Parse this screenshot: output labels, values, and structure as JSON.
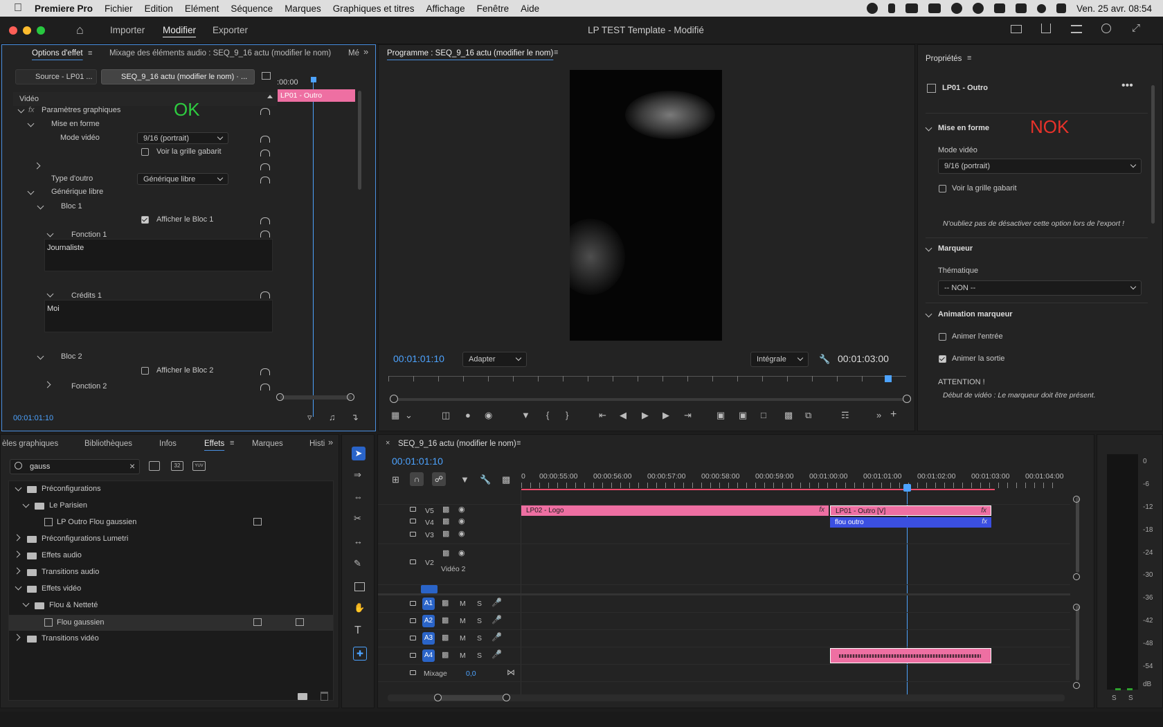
{
  "menubar": {
    "app": "Premiere Pro",
    "items": [
      "Fichier",
      "Edition",
      "Elément",
      "Séquence",
      "Marques",
      "Graphiques et titres",
      "Affichage",
      "Fenêtre",
      "Aide"
    ],
    "clock": "Ven. 25 avr.  08:54"
  },
  "titlebar": {
    "title": "LP TEST Template - Modifié",
    "ws": {
      "import": "Importer",
      "edit": "Modifier",
      "export": "Exporter"
    }
  },
  "effect_panel": {
    "tabs": {
      "options": "Options d'effet",
      "mixer": "Mixage des éléments audio : SEQ_9_16 actu (modifier le nom)",
      "more": "Mé"
    },
    "source_tab": "Source - LP01 ...",
    "seq_tab": "SEQ_9_16 actu (modifier le nom) · ...",
    "ruler": ":00:00",
    "clip_label": "LP01 - Outro",
    "ok": "OK",
    "video": "Vidéo",
    "fx": "fx",
    "graphic_params": "Paramètres graphiques",
    "mise_en_forme": "Mise en forme",
    "mode_video_label": "Mode vidéo",
    "mode_video_value": "9/16 (portrait)",
    "grid_label": "Voir la grille gabarit",
    "outro_type_label": "Type d'outro",
    "outro_type_value": "Générique libre",
    "generique": "Générique libre",
    "bloc1": "Bloc 1",
    "show_bloc1": "Afficher le Bloc 1",
    "fonction1": "Fonction 1",
    "fonction1_text": "Journaliste",
    "credits1": "Crédits 1",
    "credits1_text": "Moi",
    "bloc2": "Bloc 2",
    "show_bloc2": "Afficher le Bloc 2",
    "fonction2": "Fonction 2",
    "timecode": "00:01:01:10"
  },
  "program": {
    "title": "Programme : SEQ_9_16 actu (modifier le nom)",
    "tc_left": "00:01:01:10",
    "fit": "Adapter",
    "quality": "Intégrale",
    "tc_right": "00:01:03:00"
  },
  "properties": {
    "title": "Propriétés",
    "clip": "LP01 - Outro",
    "nok": "NOK",
    "mise_en_forme": "Mise en forme",
    "mode_video_label": "Mode vidéo",
    "mode_video_value": "9/16 (portrait)",
    "grid_label": "Voir la grille gabarit",
    "note": "N'oubliez pas de désactiver cette option lors de l'export !",
    "marqueur": "Marqueur",
    "thematique": "Thématique",
    "thematique_value": "-- NON --",
    "anim": "Animation marqueur",
    "anim_in": "Animer l'entrée",
    "anim_out": "Animer la sortie",
    "attention": "ATTENTION !",
    "debut": "Début de vidéo : Le marqueur doit être présent."
  },
  "effects_panel": {
    "tabs": {
      "modeles": "èles graphiques",
      "biblio": "Bibliothèques",
      "infos": "Infos",
      "effets": "Effets",
      "marques": "Marques",
      "hist": "Histi"
    },
    "search": "gauss",
    "badges": [
      "32",
      "YUV"
    ],
    "tree": [
      "Préconfigurations",
      "Le Parisien",
      "LP Outro Flou gaussien",
      "Préconfigurations Lumetri",
      "Effets audio",
      "Transitions audio",
      "Effets vidéo",
      "Flou & Netteté",
      "Flou gaussien",
      "Transitions vidéo"
    ]
  },
  "timeline": {
    "title": "SEQ_9_16 actu (modifier le nom)",
    "timecode": "00:01:01:10",
    "ruler": [
      "0",
      "00:00:55:00",
      "00:00:56:00",
      "00:00:57:00",
      "00:00:58:00",
      "00:00:59:00",
      "00:01:00:00",
      "00:01:01:00",
      "00:01:02:00",
      "00:01:03:00",
      "00:01:04:00"
    ],
    "video_tracks": [
      "V5",
      "V4",
      "V3",
      "V2"
    ],
    "v2_name": "Vidéo 2",
    "audio_tracks": [
      "A1",
      "A2",
      "A3",
      "A4"
    ],
    "m": "M",
    "s": "S",
    "mix": "Mixage",
    "mix_val": "0,0",
    "clips": {
      "logo": "LP02 - Logo",
      "outro": "LP01 - Outro [V]",
      "flou": "flou outro",
      "fx": "fx"
    }
  },
  "meter": {
    "labels": [
      "0",
      "-6",
      "-12",
      "-18",
      "-24",
      "-30",
      "-36",
      "-42",
      "-48",
      "-54",
      "dB"
    ],
    "bottom": [
      "S",
      "S"
    ]
  },
  "colors": {
    "accent": "#4da3ff",
    "pink": "#ee6fa2",
    "blue_clip": "#3b4fe0",
    "ok": "#2ecc40",
    "nok": "#e8322a"
  }
}
